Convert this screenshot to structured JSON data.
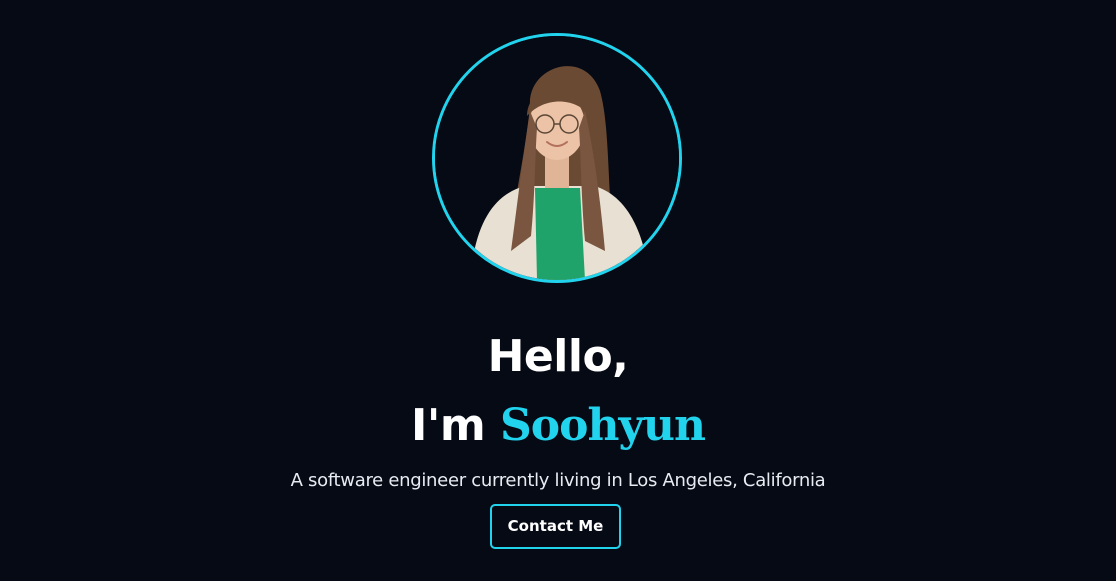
{
  "hero": {
    "greeting_line1": "Hello,",
    "greeting_prefix": "I'm ",
    "name": "Soohyun",
    "tagline": "A software engineer currently living in Los Angeles, California",
    "contact_button": "Contact Me"
  },
  "colors": {
    "background": "#060a14",
    "accent": "#22d3ee",
    "text": "#ffffff"
  }
}
